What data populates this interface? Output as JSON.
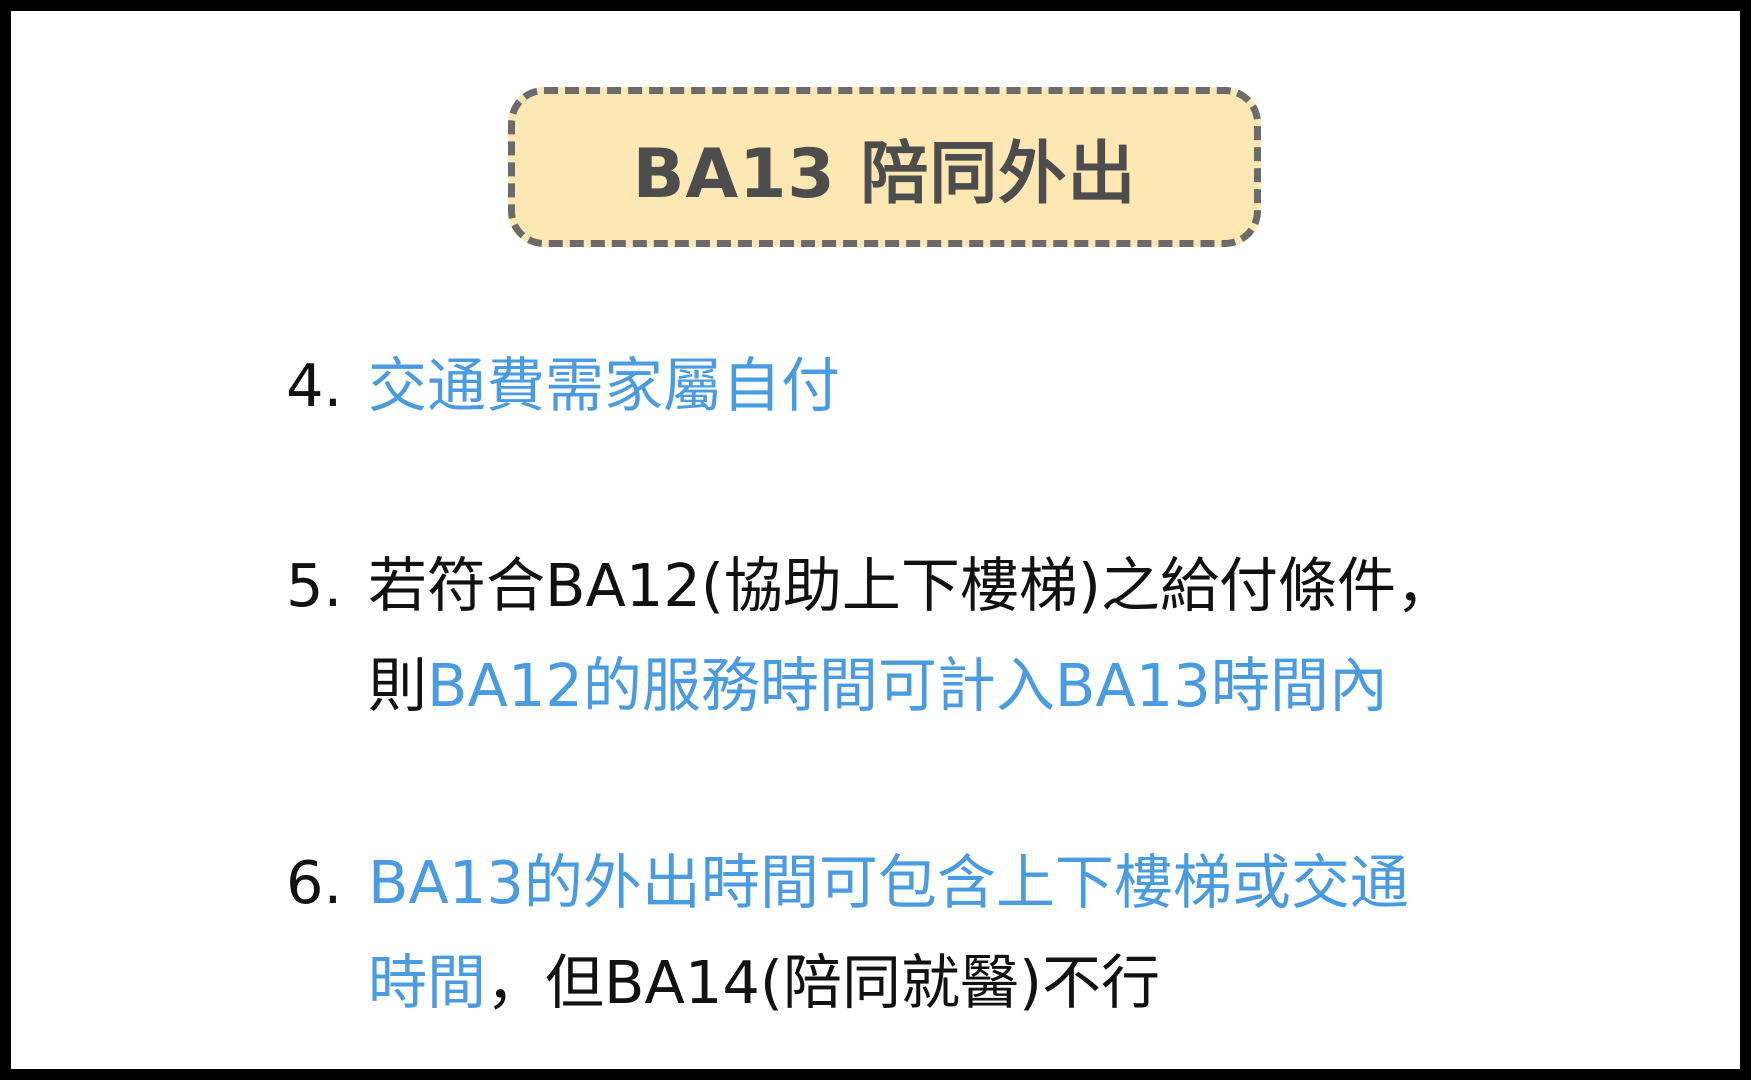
{
  "title": "BA13 陪同外出",
  "items": [
    {
      "number": "4.",
      "line1": [
        {
          "text": "交通費需家屬自付",
          "color": "blue"
        }
      ]
    },
    {
      "number": "5.",
      "line1": [
        {
          "text": "若符合BA12(協助上下樓梯)之給付條件，",
          "color": "black"
        }
      ],
      "line2": [
        {
          "text": "則",
          "color": "black"
        },
        {
          "text": "BA12的服務時間可計入BA13時間內",
          "color": "blue"
        }
      ]
    },
    {
      "number": "6.",
      "line1": [
        {
          "text": "BA13的外出時間可包含上下樓梯或交通",
          "color": "blue"
        }
      ],
      "line2": [
        {
          "text": "時間",
          "color": "blue"
        },
        {
          "text": "，但BA14(陪同就醫)不行",
          "color": "black"
        }
      ]
    }
  ],
  "colors": {
    "accent_blue": "#4a9be0",
    "text_black": "#111111",
    "title_fill": "#fde7b2",
    "title_border": "#6b6b6b",
    "title_text": "#4d4d4d",
    "frame": "#000000"
  }
}
